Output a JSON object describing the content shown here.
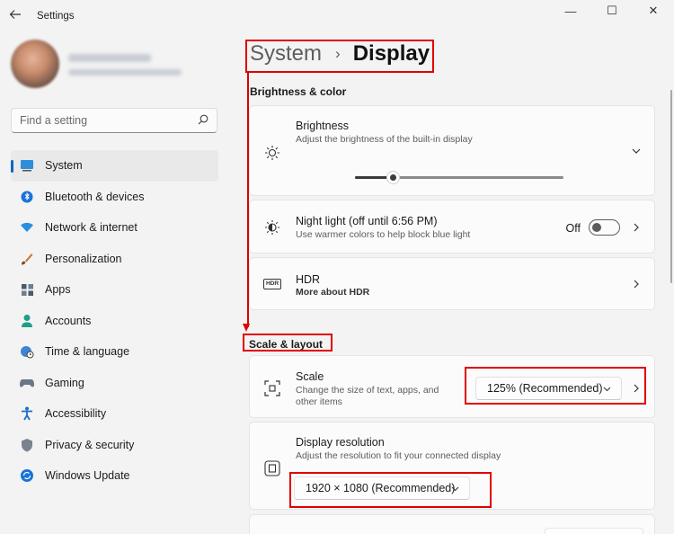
{
  "window": {
    "title": "Settings",
    "minimize_glyph": "—",
    "maximize_glyph": "☐",
    "close_glyph": "✕"
  },
  "search": {
    "placeholder": "Find a setting"
  },
  "sidebar": {
    "items": [
      {
        "label": "System",
        "icon": "system-icon",
        "active": true
      },
      {
        "label": "Bluetooth & devices",
        "icon": "bluetooth-icon"
      },
      {
        "label": "Network & internet",
        "icon": "wifi-icon"
      },
      {
        "label": "Personalization",
        "icon": "brush-icon"
      },
      {
        "label": "Apps",
        "icon": "apps-icon"
      },
      {
        "label": "Accounts",
        "icon": "account-icon"
      },
      {
        "label": "Time & language",
        "icon": "globe-clock-icon"
      },
      {
        "label": "Gaming",
        "icon": "gamepad-icon"
      },
      {
        "label": "Accessibility",
        "icon": "accessibility-icon"
      },
      {
        "label": "Privacy & security",
        "icon": "shield-icon"
      },
      {
        "label": "Windows Update",
        "icon": "update-icon"
      }
    ]
  },
  "breadcrumb": {
    "parent": "System",
    "current": "Display"
  },
  "sections": {
    "brightness_color": "Brightness & color",
    "scale_layout": "Scale & layout"
  },
  "brightness": {
    "title": "Brightness",
    "description": "Adjust the brightness of the built-in display",
    "level_fraction": 0.18
  },
  "night_light": {
    "title": "Night light (off until 6:56 PM)",
    "description": "Use warmer colors to help block blue light",
    "state_label": "Off"
  },
  "hdr": {
    "title": "HDR",
    "link": "More about HDR",
    "icon_text": "HDR"
  },
  "scale": {
    "title": "Scale",
    "description_line1": "Change the size of text, apps, and",
    "description_line2": "other items",
    "value": "125% (Recommended)"
  },
  "resolution": {
    "title": "Display resolution",
    "description": "Adjust the resolution to fit your connected display",
    "value": "1920 × 1080 (Recommended)"
  },
  "colors": {
    "accent": "#0067c0",
    "annotation": "#e00000"
  }
}
